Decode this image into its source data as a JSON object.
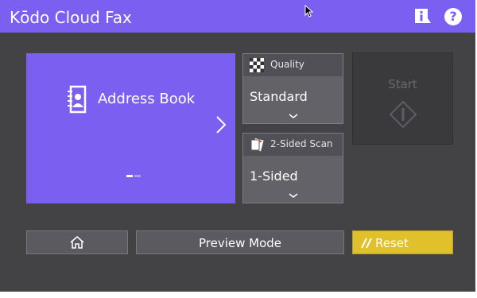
{
  "header": {
    "title": "Kōdo Cloud Fax",
    "icons": [
      "info-icon",
      "help-icon"
    ],
    "help_glyph": "?"
  },
  "address_book": {
    "label": "Address Book",
    "icon": "address-book-icon",
    "pages_total": 2,
    "page_current": 1
  },
  "settings": {
    "quality": {
      "label": "Quality",
      "value": "Standard",
      "icon": "checkerboard-icon"
    },
    "sided": {
      "label": "2-Sided Scan",
      "value": "1-Sided",
      "icon": "two-sided-scan-icon"
    }
  },
  "start": {
    "label": "Start",
    "enabled": false
  },
  "bottom": {
    "home_icon": "home-icon",
    "preview_label": "Preview Mode",
    "reset_label": "Reset"
  },
  "colors": {
    "accent": "#7a5ff0",
    "panel": "#434346",
    "reset": "#e0c12b"
  }
}
